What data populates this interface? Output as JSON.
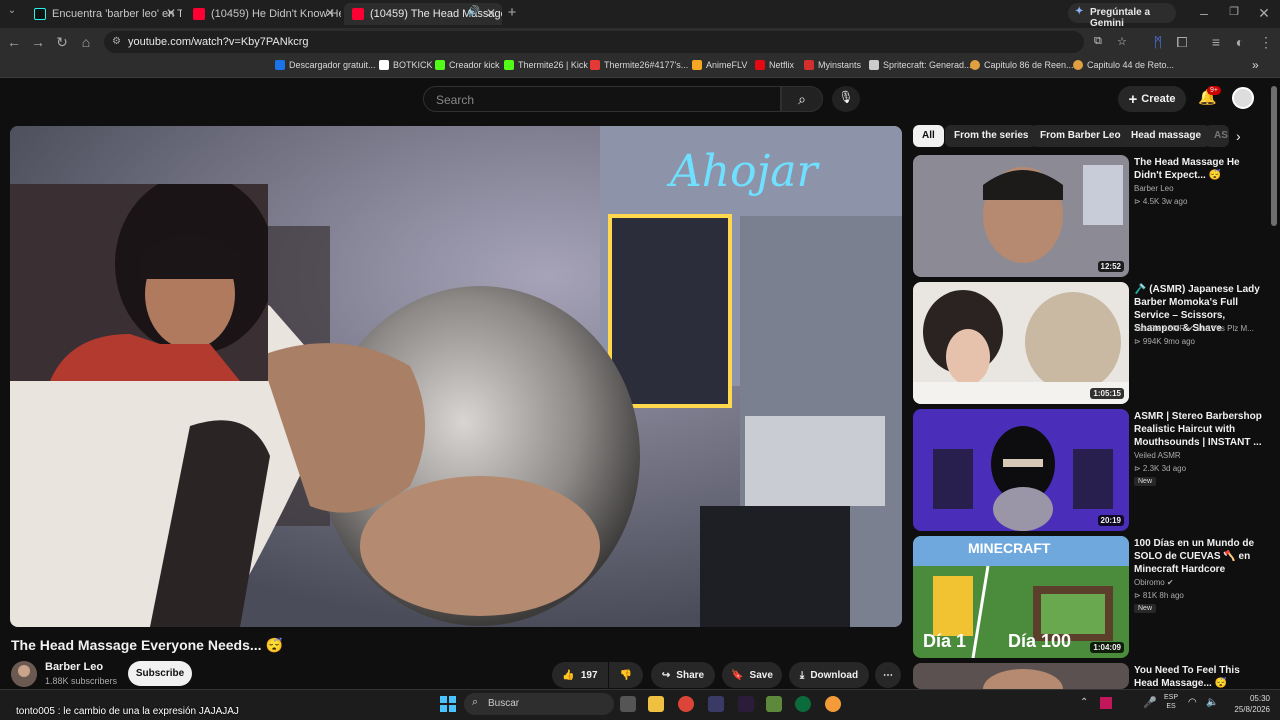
{
  "browser": {
    "tabs": [
      {
        "label": "Encuentra 'barber leo' en TikTok",
        "icon": "tiktok-icon",
        "active": false
      },
      {
        "label": "(10459) He Didn't Know He Co",
        "icon": "youtube-icon",
        "active": false
      },
      {
        "label": "(10459) The Head Massage",
        "icon": "youtube-icon",
        "active": true
      }
    ],
    "gemini_label": "Pregúntale a Gemini",
    "url": "youtube.com/watch?v=Kby7PANkcrg",
    "bookmarks": [
      {
        "label": "Descargador gratuit...",
        "color": "#1a73e8"
      },
      {
        "label": "BOTKICK",
        "color": "#ffffff"
      },
      {
        "label": "Creador kick",
        "color": "#53fc18"
      },
      {
        "label": "Thermite26 | Kick",
        "color": "#53fc18"
      },
      {
        "label": "Thermite26#4177's...",
        "color": "#e53935"
      },
      {
        "label": "AnimeFLV",
        "color": "#f5a623"
      },
      {
        "label": "Netflix",
        "color": "#e50914"
      },
      {
        "label": "Myinstants",
        "color": "#d32f2f"
      },
      {
        "label": "Spritecraft: Generad...",
        "color": "#cccccc"
      },
      {
        "label": "Capitulo 86 de Reen...",
        "color": "#e0a040"
      },
      {
        "label": "Capitulo 44 de Reto...",
        "color": "#e0a040"
      }
    ]
  },
  "youtube": {
    "search_placeholder": "Search",
    "create_label": "Create",
    "notif_badge": "9+",
    "video": {
      "title": "The Head Massage Everyone Needs... 😴",
      "channel": "Barber Leo",
      "subscribers": "1.88K subscribers",
      "subscribe_label": "Subscribe",
      "likes": "197",
      "share_label": "Share",
      "save_label": "Save",
      "download_label": "Download"
    },
    "chips": [
      "All",
      "From the series",
      "From Barber Leo",
      "Head massage",
      "AS"
    ],
    "recommendations": [
      {
        "title": "The Head Massage He Didn't Expect... 😴",
        "channel": "Barber Leo",
        "meta": "⊳ 4.5K  3w ago",
        "duration": "12:52",
        "new": ""
      },
      {
        "title": "🪒 (ASMR) Japanese Lady Barber Momoka's Full Service – Scissors, Shampoo & Shave",
        "channel": "Yes Plz ASMR ✔ and Yes Plz M...",
        "meta": "⊳ 994K  9mo ago",
        "duration": "1:05:15",
        "new": ""
      },
      {
        "title": "ASMR | Stereo Barbershop Realistic Haircut with Mouthsounds | INSTANT ...",
        "channel": "Veiled ASMR",
        "meta": "⊳ 2.3K  3d ago",
        "duration": "20:19",
        "new": "New"
      },
      {
        "title": "100 Días en un Mundo de SOLO de CUEVAS 🪓 en Minecraft Hardcore",
        "channel": "Obiromo ✔",
        "meta": "⊳ 81K  8h ago",
        "duration": "1:04:09",
        "new": "New"
      },
      {
        "title": "You Need To Feel This Head Massage... 😴",
        "channel": "",
        "meta": "",
        "duration": "",
        "new": ""
      }
    ],
    "minecraft_thumb": {
      "title": "MINECRAFT",
      "day1": "Día 1",
      "day100": "Día 100"
    }
  },
  "overlay": {
    "chat_line": "tonto005 : le cambio de una la expresión JAJAJAJ"
  },
  "taskbar": {
    "search_label": "Buscar",
    "lang": "ESP",
    "lang2": "ES",
    "time": "05:30",
    "date": "25/8/2026"
  }
}
